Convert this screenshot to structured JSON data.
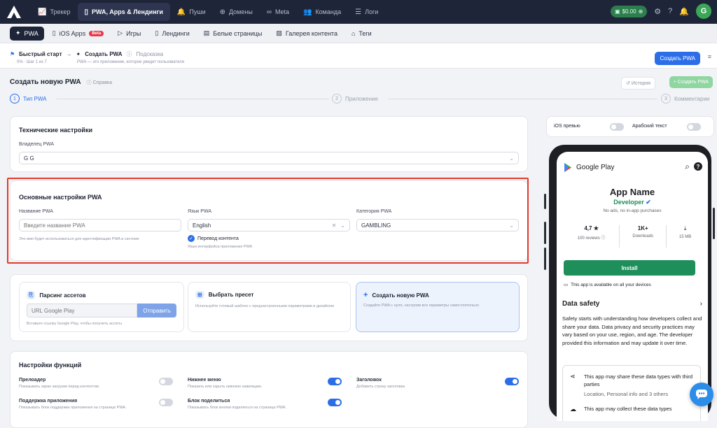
{
  "topbar": {
    "nav": [
      {
        "icon": "📈",
        "label": "Трекер"
      },
      {
        "icon": "▯",
        "label": "PWA, Apps & Лендинги"
      },
      {
        "icon": "🔔",
        "label": "Пуши"
      },
      {
        "icon": "⊕",
        "label": "Домены"
      },
      {
        "icon": "∞",
        "label": "Meta"
      },
      {
        "icon": "👥",
        "label": "Команда"
      },
      {
        "icon": "☰",
        "label": "Логи"
      }
    ],
    "balance": "$0.00",
    "avatar": "G"
  },
  "subnav": [
    {
      "label": "PWA"
    },
    {
      "label": "iOS Apps",
      "badge": "Beta"
    },
    {
      "label": "Игры"
    },
    {
      "label": "Лендинги"
    },
    {
      "label": "Белые страницы"
    },
    {
      "label": "Галерея контента"
    },
    {
      "label": "Теги"
    }
  ],
  "quickstart": {
    "title": "Быстрый старт",
    "arrow": "→",
    "step": "Создать PWA",
    "hint": "Подсказка",
    "progress": "0% · Шаг 1 из 7",
    "desc": "PWA — это приложение, которое увидит пользователи",
    "button": "Создать PWA"
  },
  "page": {
    "title": "Создать новую PWA",
    "help": "Справка",
    "history": "История",
    "create": "Создать PWA"
  },
  "steps": [
    {
      "num": "1",
      "label": "Тип PWA"
    },
    {
      "num": "2",
      "label": "Приложение"
    },
    {
      "num": "3",
      "label": "Комментарии"
    }
  ],
  "tech": {
    "title": "Технические настройки",
    "owner_label": "Владелец PWA",
    "owner_value": "G G"
  },
  "basic": {
    "title": "Основные настройки PWA",
    "name_label": "Название PWA",
    "name_placeholder": "Введите название PWA",
    "name_hint": "Это имя будет использоваться для идентификации PWA в системе",
    "lang_label": "Язык PWA",
    "lang_value": "English",
    "translate_label": "Перевод контента",
    "translate_hint": "Язык интерфейса приложения PWA",
    "cat_label": "Категория PWA",
    "cat_value": "GAMBLING"
  },
  "options": [
    {
      "title": "Парсинг ассетов",
      "input_placeholder": "URL Google Play",
      "button": "Отправить",
      "hint": "Вставьте ссылку Google Play, чтобы получить ассеты"
    },
    {
      "title": "Выбрать пресет",
      "desc": "Используйте готовый шаблон с преднастроенными параметрами и дизайном"
    },
    {
      "title": "Создать новую PWA",
      "desc": "Создайте PWA с нуля, настроив все параметры самостоятельно"
    }
  ],
  "features": {
    "title": "Настройки функций",
    "items": [
      {
        "name": "Прелоадер",
        "desc": "Показывать экран загрузки перед контентом.",
        "on": false
      },
      {
        "name": "Нижнее меню",
        "desc": "Показать или скрыть нижнюю навигацию.",
        "on": true
      },
      {
        "name": "Заголовок",
        "desc": "Добавить строку заголовка",
        "on": true
      },
      {
        "name": "Поддержка приложения",
        "desc": "Показывать блок поддержки приложения на странице PWA.",
        "on": false
      },
      {
        "name": "Блок поделиться",
        "desc": "Показывать блок кнопки поделиться на странице PWA.",
        "on": true
      }
    ]
  },
  "preview": {
    "ios_label": "iOS превью",
    "arabic_label": "Арабский текст",
    "store": "Google Play",
    "app_name": "App Name",
    "developer": "Developer",
    "ads": "No ads, no in-app purchases",
    "rating": "4,7 ★",
    "reviews": "100 reviews ⓘ",
    "downloads": "1K+",
    "downloads_label": "Downloads",
    "size": "15 MB",
    "install": "Install",
    "devices": "This app is available on all your devices",
    "safety_title": "Data safety",
    "safety_text": "Safety starts with understanding how developers collect and share your data. Data privacy and security practices may vary based on your use, region, and age. The developer provided this information and may update it over time.",
    "share_title": "This app may share these data types with third parties",
    "share_sub": "Location, Personal info and 3 others",
    "collect_title": "This app may collect these data types"
  },
  "colors": {
    "accent": "#2c6ee8",
    "topbar": "#1f2538",
    "highlight": "#e53a2a",
    "install": "#1e8e5a"
  }
}
